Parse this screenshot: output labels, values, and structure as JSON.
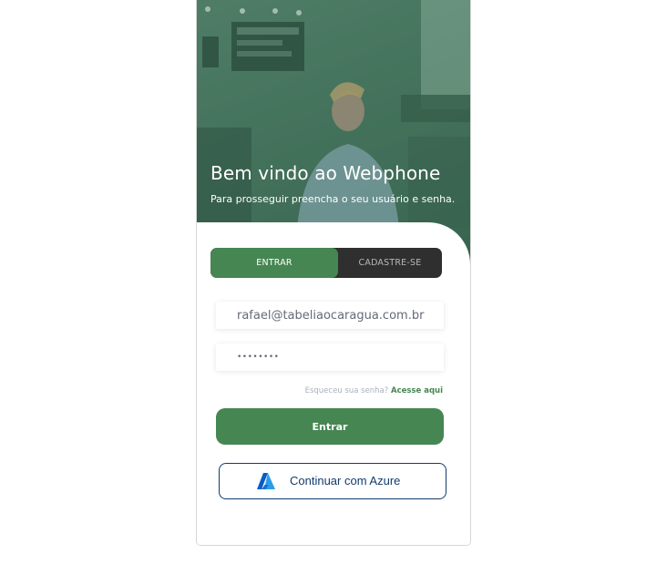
{
  "hero": {
    "title": "Bem vindo ao Webphone",
    "subtitle": "Para prosseguir preencha o seu usuário e senha."
  },
  "tabs": [
    {
      "label": "ENTRAR",
      "active": true
    },
    {
      "label": "CADASTRE-SE",
      "active": false
    }
  ],
  "form": {
    "email_value": "rafael@tabeliaocaragua.com.br",
    "password_value": "••••••••",
    "forgot_text": "Esqueceu sua senha?",
    "forgot_link": "Acesse aqui",
    "login_button": "Entrar",
    "azure_button": "Continuar com Azure"
  },
  "colors": {
    "brand_green": "#468653",
    "tab_bar": "#2f2f2f",
    "azure_text": "#123b6d"
  },
  "icons": {
    "azure": "azure-logo-icon"
  }
}
